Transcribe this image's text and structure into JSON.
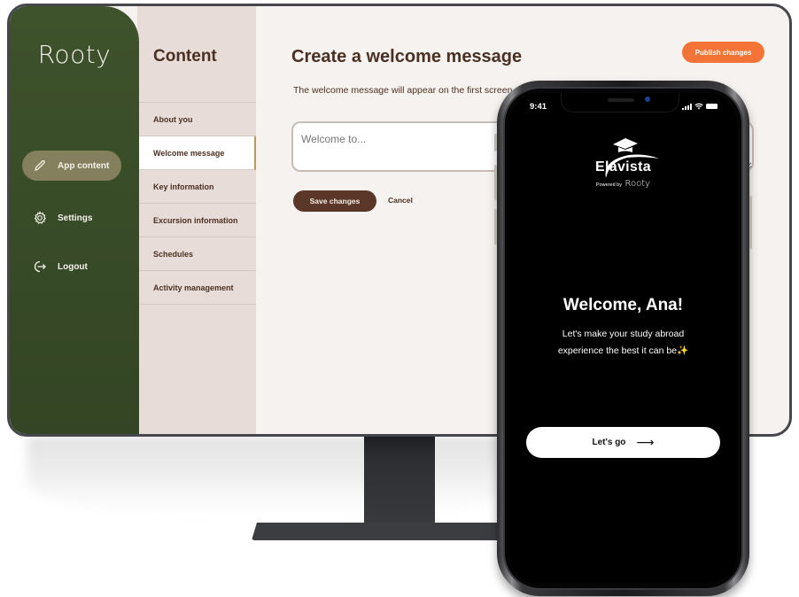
{
  "desktop": {
    "logo": "Rooty",
    "nav": [
      {
        "label": "App content",
        "icon": "pencil-icon",
        "active": true
      },
      {
        "label": "Settings",
        "icon": "gear-icon",
        "active": false
      },
      {
        "label": "Logout",
        "icon": "logout-icon",
        "active": false
      }
    ],
    "submenu": {
      "title": "Content",
      "items": [
        {
          "label": "About you",
          "active": false
        },
        {
          "label": "Welcome message",
          "active": true
        },
        {
          "label": "Key information",
          "active": false
        },
        {
          "label": "Excursion information",
          "active": false
        },
        {
          "label": "Schedules",
          "active": false
        },
        {
          "label": "Activity management",
          "active": false
        }
      ]
    },
    "main": {
      "title": "Create a welcome message",
      "description": "The welcome message will appear on the first screen",
      "input_placeholder": "Welcome to...",
      "save_label": "Save changes",
      "cancel_label": "Cancel",
      "publish_label": "Publish changes"
    },
    "colors": {
      "sidebar": "#3e522c",
      "nav_active": "#847f5c",
      "submenu_bg": "#e8dcd8",
      "text_brown": "#4a3022",
      "publish": "#f37436",
      "save": "#5a3728"
    }
  },
  "phone": {
    "status_time": "9:41",
    "brand": "Elavista",
    "powered_by": "Powered by",
    "powered_brand": "Rooty",
    "welcome_title": "Welcome, Ana!",
    "welcome_line1": "Let's make your study abroad",
    "welcome_line2": "experience the best it can be",
    "sparkle": "✨",
    "cta_label": "Let's go",
    "cta_arrow": "⟶"
  }
}
